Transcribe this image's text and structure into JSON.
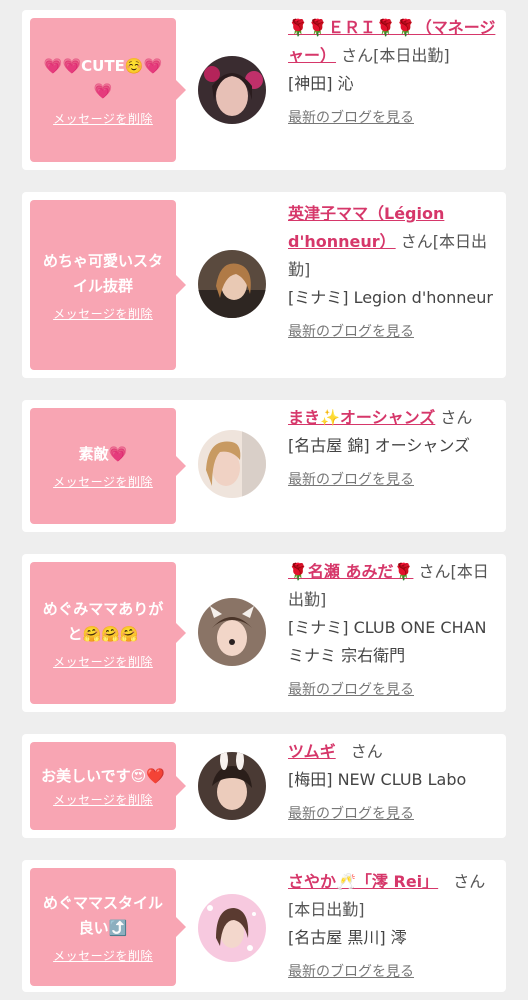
{
  "delete_label": "メッセージを削除",
  "blog_label": "最新のブログを見る",
  "san_label": "さん",
  "colors": {
    "bubble": "#f8a5b3",
    "link": "#d6376a",
    "background": "#eeeeee"
  },
  "cards": [
    {
      "message": "💗💗CUTE☺️💗💗",
      "name": "🌹🌹ＥＲＩ🌹🌹（マネージャー）",
      "status": "[本日出勤]",
      "shop": "[神田] 沁"
    },
    {
      "message": "めちゃ可愛いスタイル抜群",
      "name": "英津子ママ（Légion d'honneur）",
      "status": "[本日出勤]",
      "shop": "[ミナミ] Legion d'honneur"
    },
    {
      "message": "素敵💗",
      "name": "まき✨オーシャンズ",
      "status": "",
      "shop": "[名古屋 錦] オーシャンズ"
    },
    {
      "message": "めぐみママありがと🤗🤗🤗",
      "name": "🌹名瀬 あみだ🌹",
      "status": "[本日出勤]",
      "shop": "[ミナミ] CLUB ONE CHAN ミナミ 宗右衛門"
    },
    {
      "message": "お美しいです😍❤️",
      "name": "ツムギ",
      "status": "",
      "shop": "[梅田] NEW CLUB Labo"
    },
    {
      "message": "めぐママスタイル良い⤴️",
      "name": "さやか🥂「澪 Rei」",
      "status": "[本日出勤]",
      "shop": "[名古屋 黒川] 澪"
    }
  ]
}
